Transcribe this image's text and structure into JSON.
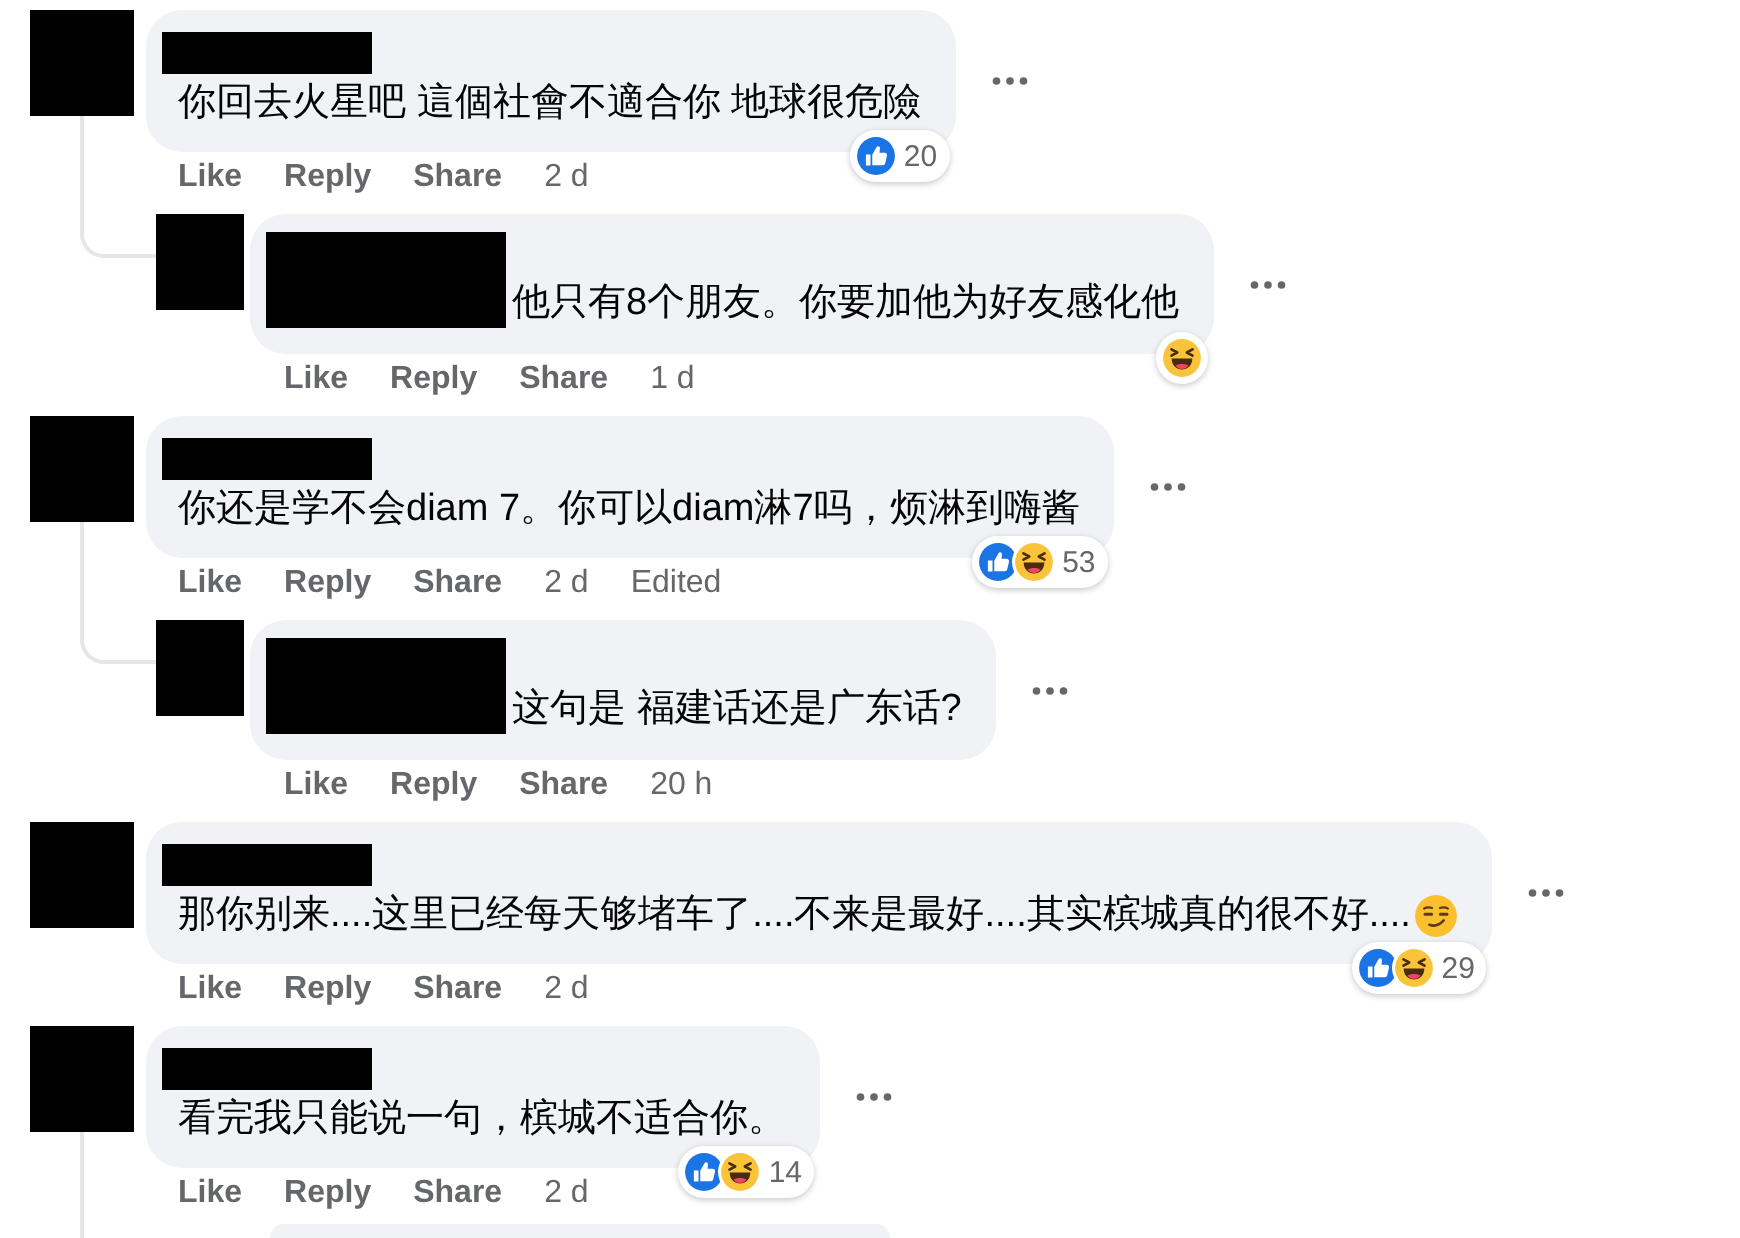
{
  "comments": [
    {
      "redacted": true,
      "text": "你回去火星吧 這個社會不適合你 地球很危險",
      "reactions": [
        {
          "kind": "like"
        }
      ],
      "reaction_count": "20",
      "actions": [
        "Like",
        "Reply",
        "Share"
      ],
      "time": "2 d",
      "replies": [
        {
          "kind": "comment",
          "redacted": true,
          "text": "他只有8个朋友。你要加他为好友感化他",
          "reactions": [
            {
              "kind": "haha"
            }
          ],
          "actions": [
            "Like",
            "Reply",
            "Share"
          ],
          "time": "1 d"
        }
      ]
    },
    {
      "redacted": true,
      "text": "你还是学不会diam 7。你可以diam淋7吗，烦淋到嗨酱",
      "reactions": [
        {
          "kind": "like"
        },
        {
          "kind": "haha"
        }
      ],
      "reaction_count": "53",
      "actions": [
        "Like",
        "Reply",
        "Share"
      ],
      "time": "2 d",
      "edited": "Edited",
      "replies": [
        {
          "kind": "comment",
          "redacted": true,
          "text": "这句是 福建话还是广东话?",
          "actions": [
            "Like",
            "Reply",
            "Share"
          ],
          "time": "20 h"
        }
      ]
    },
    {
      "redacted": true,
      "text": "那你别来....这里已经每天够堵车了....不来是最好....其实槟城真的很不好....",
      "trailing_emoji": true,
      "reactions": [
        {
          "kind": "like"
        },
        {
          "kind": "haha"
        }
      ],
      "reaction_count": "29",
      "actions": [
        "Like",
        "Reply",
        "Share"
      ],
      "time": "2 d"
    },
    {
      "redacted": true,
      "text": "看完我只能说一句，槟城不适合你。",
      "reactions": [
        {
          "kind": "like"
        },
        {
          "kind": "haha"
        }
      ],
      "reaction_count": "14",
      "actions": [
        "Like",
        "Reply",
        "Share"
      ],
      "time": "2 d",
      "replies": [
        {
          "kind": "cut_off"
        }
      ]
    }
  ]
}
